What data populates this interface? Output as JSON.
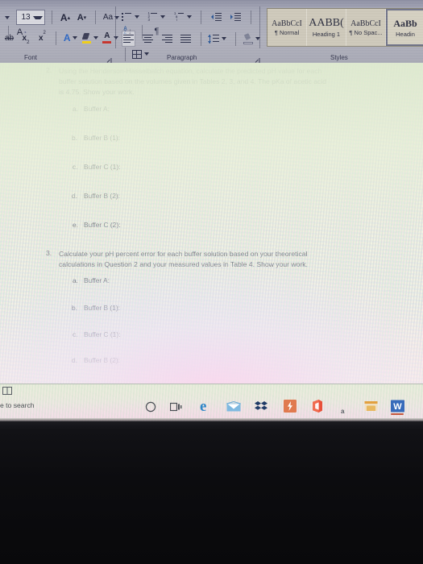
{
  "app": {
    "name": "Microsoft Word",
    "window_kind": "photo-of-screen"
  },
  "ribbon": {
    "font_group": {
      "label": "Font",
      "font_size_value": "13",
      "grow_font": "A",
      "shrink_font": "A",
      "change_case": "Aa",
      "clear_formatting": "A",
      "strikethrough": "ab",
      "subscript": "x",
      "subscript_sub": "2",
      "superscript": "x",
      "superscript_sup": "2",
      "text_effects": "A",
      "highlight": "A",
      "font_color": "A",
      "launcher": "dialog-launcher"
    },
    "paragraph_group": {
      "label": "Paragraph",
      "bullets": "bullets",
      "numbering": "numbering",
      "multilevel": "multilevel-list",
      "decrease_indent": "decrease-indent",
      "increase_indent": "increase-indent",
      "sort": "sort-az",
      "sort_a": "A",
      "sort_z": "Z",
      "show_marks": "¶",
      "align_left": "align-left",
      "align_center": "align-center",
      "align_right": "align-right",
      "justify": "justify",
      "line_spacing": "line-spacing",
      "shading": "shading",
      "borders": "borders",
      "launcher": "dialog-launcher"
    },
    "styles_group": {
      "label": "Styles",
      "items": [
        {
          "preview": "AaBbCcI",
          "name": "¶ Normal",
          "selected": false,
          "preview_size": "10px",
          "preview_weight": "400"
        },
        {
          "preview": "AABB(",
          "name": "Heading 1",
          "selected": false,
          "preview_size": "14px",
          "preview_weight": "400"
        },
        {
          "preview": "AaBbCcI",
          "name": "¶ No Spac...",
          "selected": false,
          "preview_size": "10px",
          "preview_weight": "400"
        },
        {
          "preview": "AaBb",
          "name": "Headin",
          "selected": true,
          "preview_size": "12px",
          "preview_weight": "700"
        }
      ]
    }
  },
  "document": {
    "questions": [
      {
        "number": "2.",
        "lines": [
          "Using the Henderson-Hasselbalch equation, calculate the predicted pH value for each",
          "buffer solution based on the volumes given in Tables 2, 3, and 4. The pKa of acetic acid",
          "is 4.75. Show your work."
        ],
        "items": [
          {
            "letter": "a.",
            "text": "Buffer A:"
          },
          {
            "letter": "b.",
            "text": "Buffer B (1):"
          },
          {
            "letter": "c.",
            "text": "Buffer C (1):"
          },
          {
            "letter": "d.",
            "text": "Buffer B (2):"
          },
          {
            "letter": "e.",
            "text": "Buffer C (2):"
          }
        ]
      },
      {
        "number": "3.",
        "lines": [
          "Calculate your pH percent error for each buffer solution based on your theoretical",
          "calculations in Question 2 and your measured values in Table 4. Show your work."
        ],
        "items": [
          {
            "letter": "a.",
            "text": "Buffer A:"
          },
          {
            "letter": "b.",
            "text": "Buffer B (1):"
          },
          {
            "letter": "c.",
            "text": "Buffer C (1):"
          },
          {
            "letter": "d.",
            "text": "Buffer B (2):"
          }
        ]
      }
    ]
  },
  "taskbar": {
    "search_text": "e to search",
    "icons": [
      {
        "name": "cortana-icon",
        "glyph": "○"
      },
      {
        "name": "task-view-icon",
        "glyph": "task-view"
      },
      {
        "name": "edge-icon",
        "glyph": "e"
      },
      {
        "name": "mail-icon",
        "glyph": "envelope"
      },
      {
        "name": "dropbox-icon",
        "glyph": "dropbox"
      },
      {
        "name": "lightning-app-icon",
        "glyph": "bolt"
      },
      {
        "name": "office-icon",
        "glyph": "office"
      },
      {
        "name": "small-a-icon",
        "glyph": "a"
      },
      {
        "name": "file-explorer-icon",
        "glyph": "folder"
      },
      {
        "name": "word-icon",
        "glyph": "W"
      }
    ]
  },
  "colors": {
    "ribbon_bg": "#a7a9b8",
    "page_bg": "#eef0e2",
    "text": "#2f3448",
    "edge_blue": "#2e86c8",
    "word_blue": "#2b5797",
    "accent_orange": "#e07a4f",
    "bezel": "#0c0c0f"
  }
}
